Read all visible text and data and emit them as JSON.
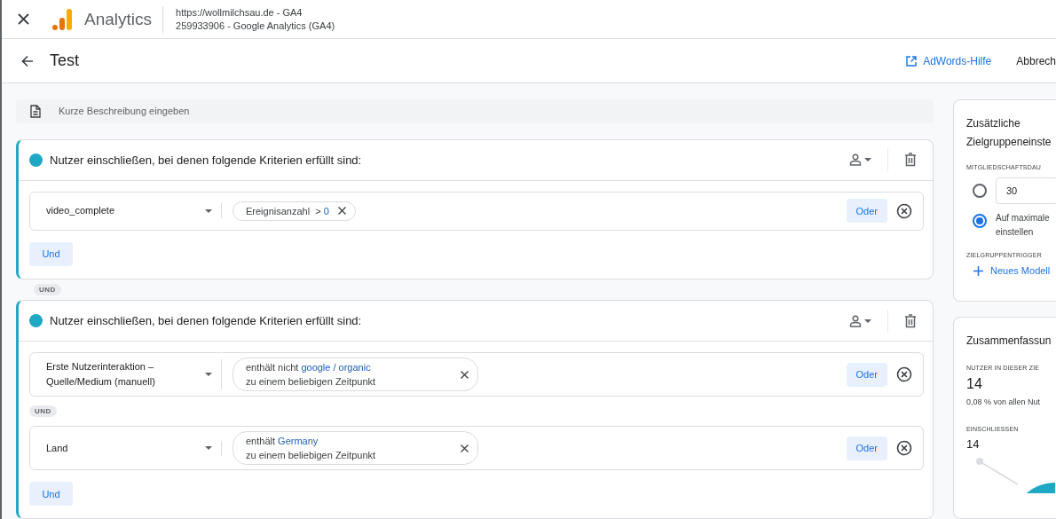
{
  "app_bar": {
    "product": "Analytics",
    "property_url": "https://wollmilchsau.de - GA4",
    "property_id": "259933906 - Google Analytics (GA4)"
  },
  "header": {
    "title": "Test",
    "help_link": "AdWords-Hilfe",
    "cancel": "Abbrech"
  },
  "description": {
    "placeholder": "Kurze Beschreibung eingeben"
  },
  "groups": [
    {
      "title": "Nutzer einschließen, bei denen folgende Kriterien erfüllt sind:",
      "color": "#1fa8c4",
      "and_button": "Und",
      "conditions": [
        {
          "kind": "event",
          "dimension": "video_complete",
          "parameter": "Ereignisanzahl",
          "operator": ">",
          "value": "0",
          "or_button": "Oder"
        }
      ]
    },
    {
      "title": "Nutzer einschließen, bei denen folgende Kriterien erfüllt sind:",
      "color": "#1fa8c4",
      "and_button": "Und",
      "conditions": [
        {
          "kind": "dimension",
          "dimension": "Erste Nutzerinteraktion –\nQuelle/Medium (manuell)",
          "operator": "enthält nicht",
          "value": "google / organic",
          "timing": "zu einem beliebigen Zeitpunkt",
          "or_button": "Oder"
        },
        {
          "kind": "dimension",
          "dimension": "Land",
          "operator": "enthält",
          "value": "Germany",
          "timing": "zu einem beliebigen Zeitpunkt",
          "or_button": "Oder"
        }
      ]
    }
  ],
  "group_connector": "UND",
  "condition_connector": "UND",
  "settings": {
    "title": "Zusätzliche\nZielgruppeneinste",
    "membership_label": "MITGLIEDSCHAFTSDAU",
    "options": [
      {
        "kind": "input",
        "value": "30",
        "selected": false
      },
      {
        "kind": "text",
        "label": "Auf maximale\neinstellen",
        "selected": true
      }
    ],
    "trigger_label": "ZIELGRUPPENTRIGGER",
    "trigger_link": "Neues Modell"
  },
  "summary": {
    "title": "Zusammenfassun",
    "users_label": "NUTZER IN DIESER ZIE",
    "users_value": "14",
    "users_share": "0,08 % von allen Nut",
    "include_label": "EINSCHLIESSEN",
    "include_value": "14"
  }
}
